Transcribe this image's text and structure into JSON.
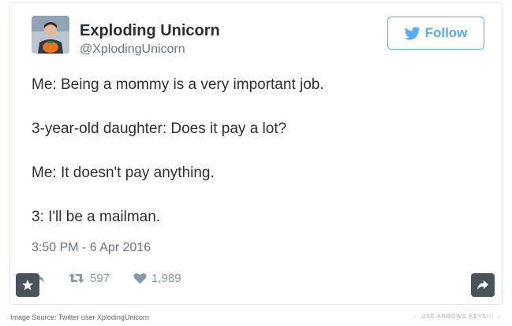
{
  "tweet": {
    "author": {
      "name": "Exploding Unicorn",
      "handle": "@XplodingUnicorn"
    },
    "follow_label": "Follow",
    "lines": [
      "Me: Being a mommy is a very important job.",
      "3-year-old daughter: Does it pay a lot?",
      "Me: It doesn't pay anything.",
      "3: I'll be a mailman."
    ],
    "timestamp": "3:50 PM - 6 Apr 2016",
    "retweets": "597",
    "likes": "1,989"
  },
  "footer": {
    "source": "Image Source: Twitter user XplodingUnicorn",
    "hint": "← USE ARROWS KEYS!!! →"
  },
  "icons": {
    "reply": "reply-icon",
    "retweet": "retweet-icon",
    "like": "heart-icon",
    "star": "star-icon",
    "share": "share-icon",
    "bird": "twitter-bird-icon"
  },
  "colors": {
    "accent": "#55acee",
    "text": "#292f33",
    "muted": "#66757f",
    "action": "#8899a6",
    "overlay_button": "#4a535c"
  }
}
